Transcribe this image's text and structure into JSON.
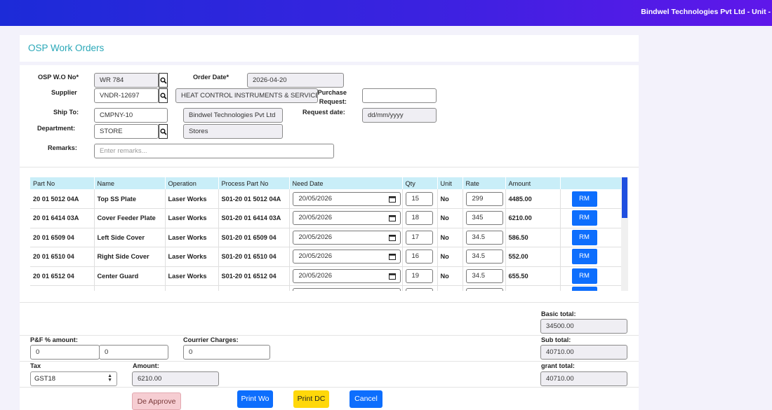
{
  "header": {
    "company": "Bindwel Technologies Pvt Ltd - Unit -"
  },
  "page": {
    "title": "OSP Work Orders"
  },
  "form": {
    "wo_no_label": "OSP W.O No*",
    "wo_no_value": "WR 784",
    "order_date_label": "Order Date*",
    "order_date_value": "2026-04-20",
    "supplier_label": "Supplier",
    "supplier_code": "VNDR-12697",
    "supplier_name": "HEAT CONTROL INSTRUMENTS & SERVICES",
    "purchase_request_label_1": "Purchase",
    "purchase_request_label_2": "Request:",
    "purchase_request_value": "",
    "ship_to_label": "Ship To:",
    "ship_to_code": "CMPNY-10",
    "ship_to_name": "Bindwel Technologies Pvt Ltd",
    "request_date_label": "Request date:",
    "request_date_placeholder": "dd/mm/yyyy",
    "department_label": "Department:",
    "department_code": "STORE",
    "department_name": "Stores",
    "remarks_label": "Remarks:",
    "remarks_placeholder": "Enter remarks..."
  },
  "table": {
    "columns": [
      "Part No",
      "Name",
      "Operation",
      "Process Part No",
      "Need Date",
      "Qty",
      "Unit",
      "Rate",
      "Amount",
      ""
    ],
    "rows": [
      {
        "part_no": "20 01 5012 04A",
        "name": "Top SS Plate",
        "operation": "Laser Works",
        "process_part_no": "S01-20 01 5012 04A",
        "need_date": "20/05/2026",
        "qty": "15",
        "unit": "No",
        "rate": "299",
        "amount": "4485.00",
        "action": "RM"
      },
      {
        "part_no": "20 01 6414 03A",
        "name": "Cover Feeder Plate",
        "operation": "Laser Works",
        "process_part_no": "S01-20 01 6414 03A",
        "need_date": "20/05/2026",
        "qty": "18",
        "unit": "No",
        "rate": "345",
        "amount": "6210.00",
        "action": "RM"
      },
      {
        "part_no": "20 01 6509 04",
        "name": "Left Side Cover",
        "operation": "Laser Works",
        "process_part_no": "S01-20 01 6509 04",
        "need_date": "20/05/2026",
        "qty": "17",
        "unit": "No",
        "rate": "34.5",
        "amount": "586.50",
        "action": "RM"
      },
      {
        "part_no": "20 01 6510 04",
        "name": "Right Side Cover",
        "operation": "Laser Works",
        "process_part_no": "S01-20 01 6510 04",
        "need_date": "20/05/2026",
        "qty": "16",
        "unit": "No",
        "rate": "34.5",
        "amount": "552.00",
        "action": "RM"
      },
      {
        "part_no": "20 01 6512 04",
        "name": "Center Guard",
        "operation": "Laser Works",
        "process_part_no": "S01-20 01 6512 04",
        "need_date": "20/05/2026",
        "qty": "19",
        "unit": "No",
        "rate": "34.5",
        "amount": "655.50",
        "action": "RM"
      },
      {
        "part_no": "",
        "name": "",
        "operation": "",
        "process_part_no": "",
        "need_date": "",
        "qty": "",
        "unit": "",
        "rate": "",
        "amount": "",
        "action": ""
      }
    ]
  },
  "totals": {
    "basic_total_label": "Basic total:",
    "basic_total_value": "34500.00",
    "pf_label": "P&F %  amount:",
    "pf_percent": "0",
    "pf_amount": "0",
    "courier_label": "Courrier Charges:",
    "courier_value": "0",
    "sub_total_label": "Sub total:",
    "sub_total_value": "40710.00",
    "tax_label": "Tax",
    "tax_value": "GST18",
    "amount_label": "Amount:",
    "amount_value": "6210.00",
    "grant_total_label": "grant total:",
    "grant_total_value": "40710.00"
  },
  "actions": {
    "de_approve": "De Approve",
    "print_wo": "Print Wo",
    "print_dc": "Print DC",
    "cancel": "Cancel"
  },
  "colors": {
    "accent": "#0d6efd",
    "title": "#2aa8b8",
    "header_row": "#c9eef8",
    "print_dc": "#ffd80a"
  }
}
